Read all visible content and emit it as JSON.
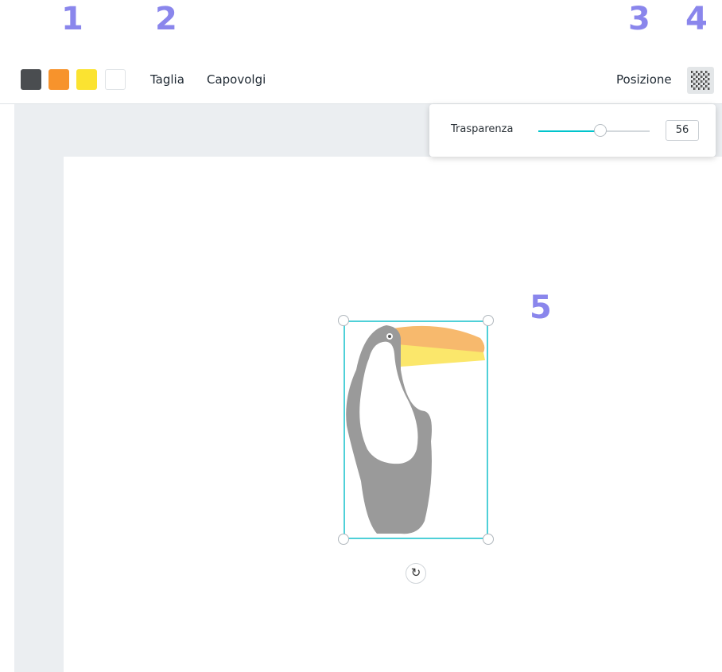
{
  "callouts": [
    "1",
    "2",
    "3",
    "4",
    "5"
  ],
  "toolbar": {
    "swatches": [
      {
        "name": "dark-gray",
        "color": "#4a4d50"
      },
      {
        "name": "orange",
        "color": "#f7932c"
      },
      {
        "name": "yellow",
        "color": "#fbe331"
      },
      {
        "name": "white",
        "color": "#ffffff"
      }
    ],
    "crop_label": "Taglia",
    "flip_label": "Capovolgi",
    "position_label": "Posizione",
    "transparency_icon": "checkerboard-icon"
  },
  "popover": {
    "label": "Trasparenza",
    "value": "56",
    "slider_fraction": 0.56
  },
  "colors": {
    "accent": "#00c4cc",
    "selection": "#4fd0d8",
    "toucan_body": "#9a9a9a",
    "beak_top": "#f7b96d",
    "beak_bottom": "#fbe76b",
    "callout": "#8a86ec"
  },
  "rotate_icon": "rotate-icon"
}
